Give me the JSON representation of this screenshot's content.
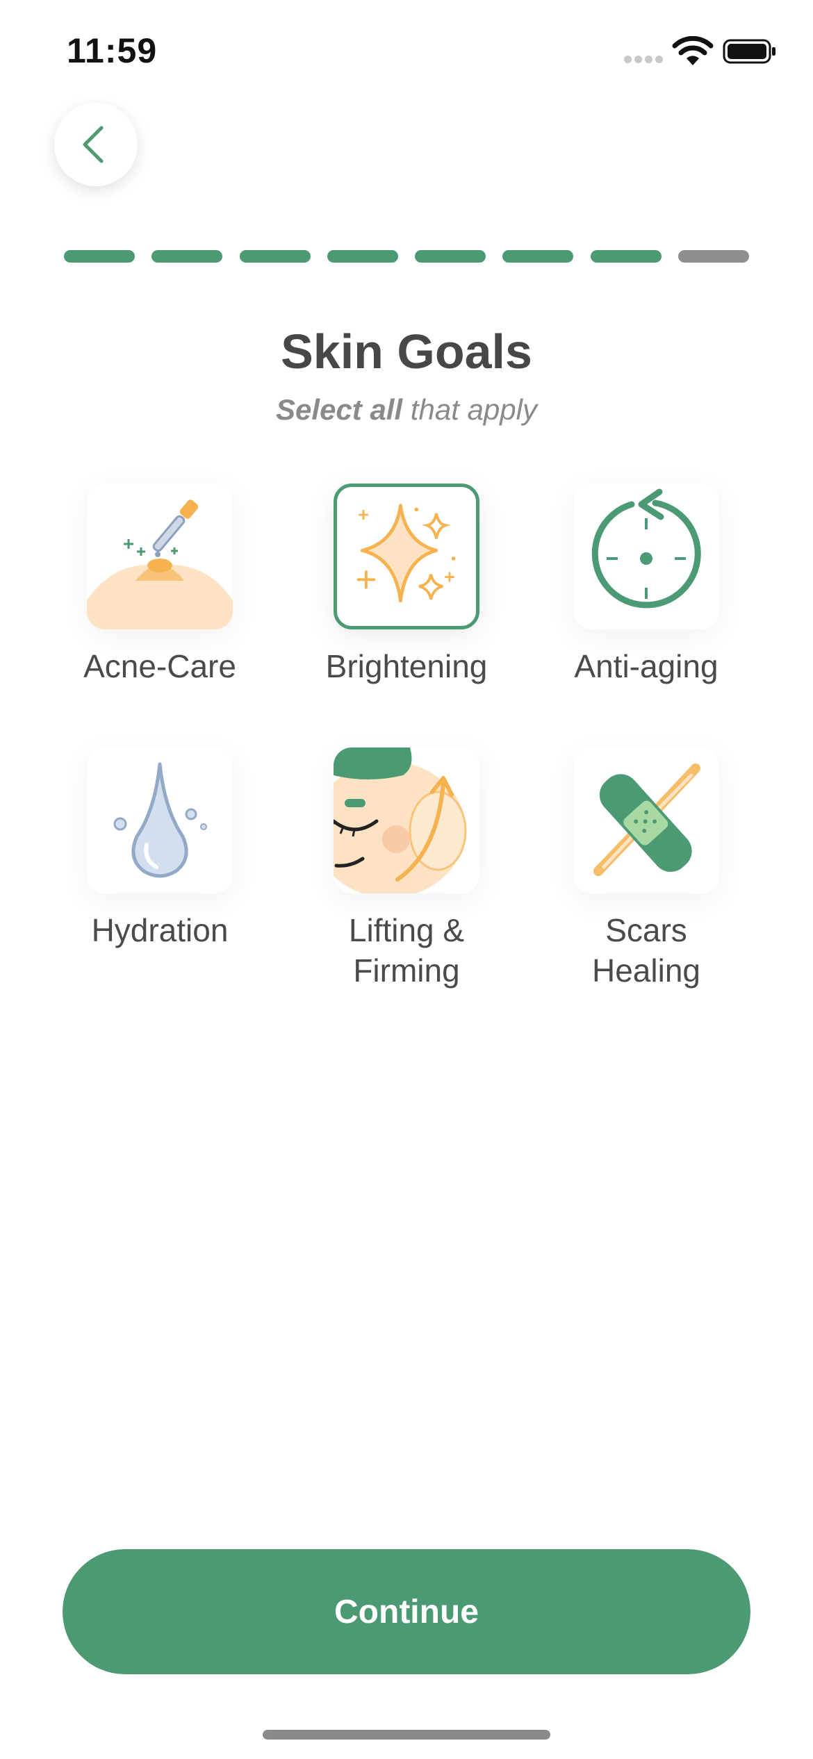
{
  "status_bar": {
    "time": "11:59"
  },
  "header": {
    "title": "Skin Goals",
    "subtitle_bold": "Select all",
    "subtitle_rest": " that apply"
  },
  "progress": {
    "total_steps": 8,
    "completed_steps": 7
  },
  "goals": [
    {
      "label": "Acne-Care",
      "icon": "acne-dropper-icon",
      "selected": false
    },
    {
      "label": "Brightening",
      "icon": "sparkle-icon",
      "selected": true
    },
    {
      "label": "Anti-aging",
      "icon": "clock-reverse-icon",
      "selected": false
    },
    {
      "label": "Hydration",
      "icon": "water-drop-icon",
      "selected": false
    },
    {
      "label": "Lifting &\nFirming",
      "icon": "face-lift-icon",
      "selected": false
    },
    {
      "label": "Scars\nHealing",
      "icon": "bandage-icon",
      "selected": false
    }
  ],
  "footer": {
    "continue_label": "Continue"
  },
  "colors": {
    "accent": "#4c9a73",
    "inactive": "#8e8e8e",
    "icon_orange": "#f5b24e"
  }
}
